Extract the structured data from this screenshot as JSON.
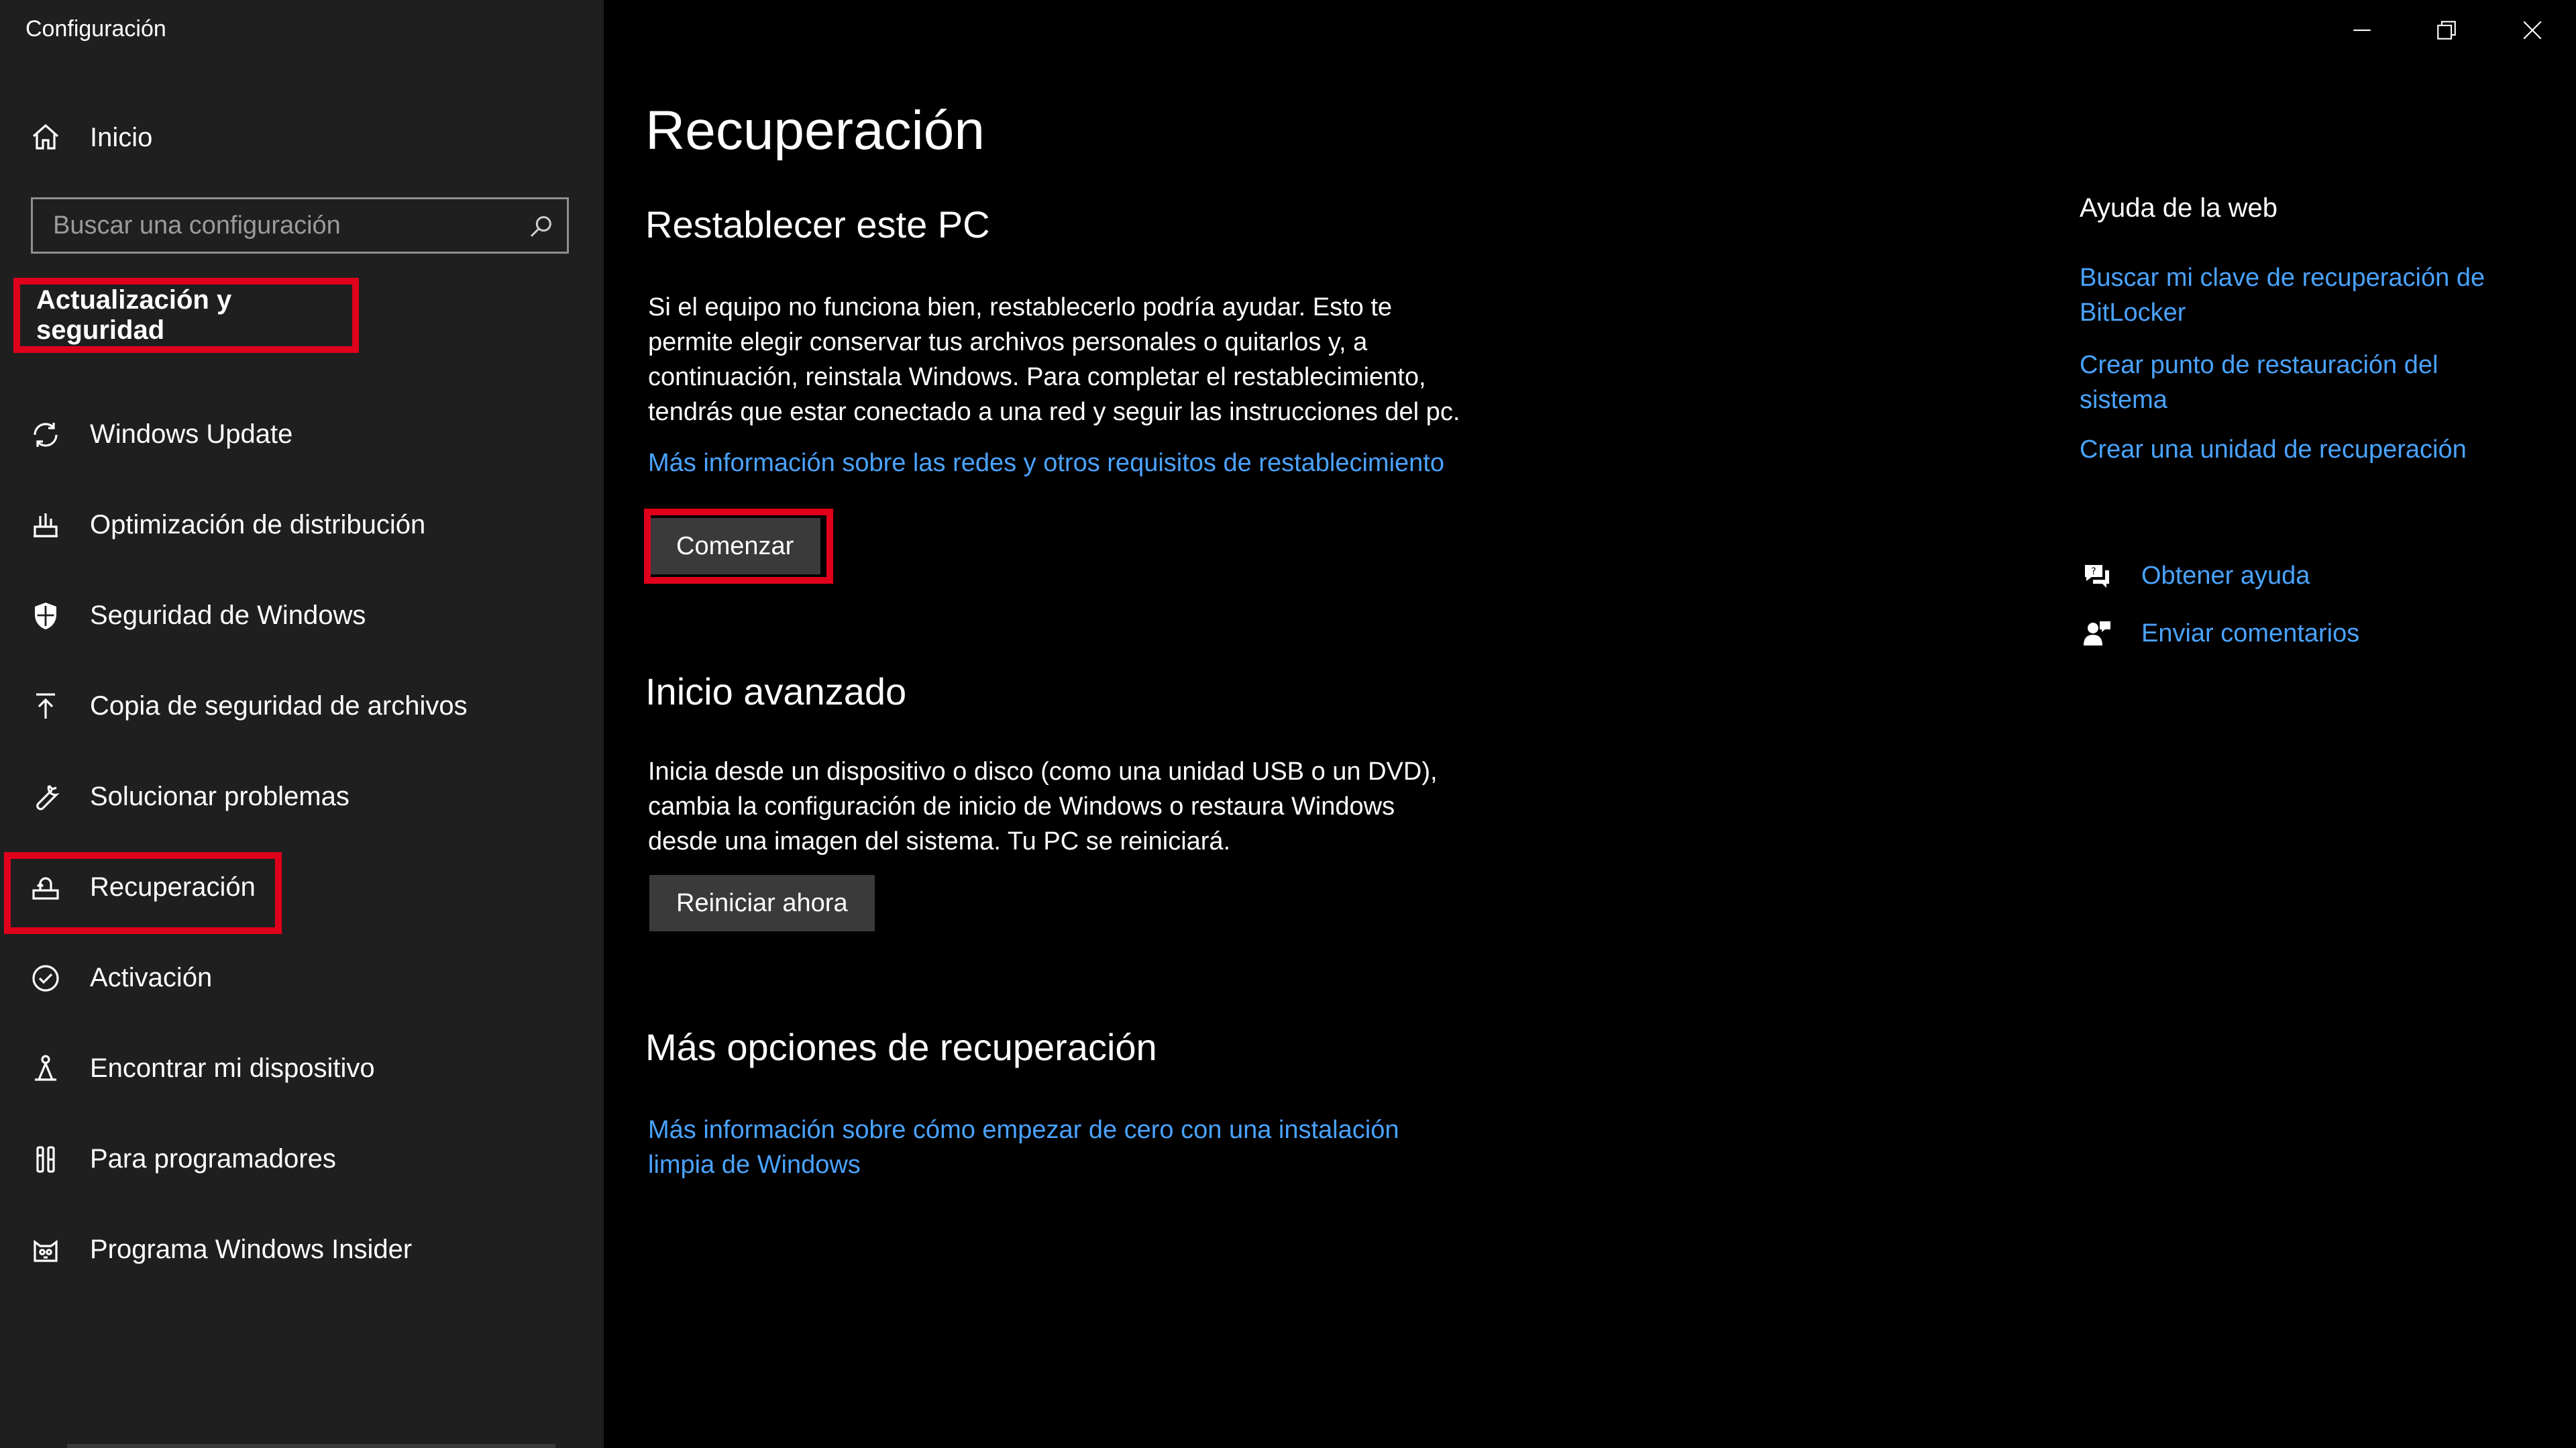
{
  "window": {
    "title": "Configuración",
    "controls": [
      "minimize-icon",
      "restore-icon",
      "close-icon"
    ]
  },
  "sidebar": {
    "home": {
      "label": "Inicio",
      "icon": "home-icon"
    },
    "search": {
      "placeholder": "Buscar una configuración",
      "value": "",
      "icon": "search-icon"
    },
    "section_label": "Actualización y seguridad",
    "items": [
      {
        "label": "Windows Update",
        "icon": "sync-icon"
      },
      {
        "label": "Optimización de distribución",
        "icon": "delivery-optimization-icon"
      },
      {
        "label": "Seguridad de Windows",
        "icon": "shield-icon"
      },
      {
        "label": "Copia de seguridad de archivos",
        "icon": "upload-arrow-icon"
      },
      {
        "label": "Solucionar problemas",
        "icon": "wrench-icon"
      },
      {
        "label": "Recuperación",
        "icon": "recovery-icon",
        "selected": true
      },
      {
        "label": "Activación",
        "icon": "check-circle-icon"
      },
      {
        "label": "Encontrar mi dispositivo",
        "icon": "person-location-icon"
      },
      {
        "label": "Para programadores",
        "icon": "developer-tools-icon"
      },
      {
        "label": "Programa Windows Insider",
        "icon": "insider-cat-icon"
      }
    ]
  },
  "main": {
    "title": "Recuperación",
    "reset": {
      "heading": "Restablecer este PC",
      "lines": [
        "Si el equipo no funciona bien, restablecerlo podría ayudar. Esto te",
        "permite elegir conservar tus archivos personales o quitarlos y, a",
        "continuación, reinstala Windows. Para completar el restablecimiento,",
        "tendrás que estar conectado a una red y seguir las instrucciones del pc."
      ],
      "link": "Más información sobre las redes y otros requisitos de restablecimiento",
      "button": "Comenzar"
    },
    "advanced": {
      "heading": "Inicio avanzado",
      "lines": [
        "Inicia desde un dispositivo o disco (como una unidad USB o un DVD),",
        "cambia la configuración de inicio de Windows o restaura Windows",
        "desde una imagen del sistema. Tu PC se reiniciará."
      ],
      "button": "Reiniciar ahora"
    },
    "more": {
      "heading": "Más opciones de recuperación",
      "link_lines": [
        "Más información sobre cómo empezar de cero con una instalación",
        "limpia de Windows"
      ]
    }
  },
  "right_panel": {
    "title": "Ayuda de la web",
    "links": [
      [
        "Buscar mi clave de recuperación de",
        "BitLocker"
      ],
      [
        "Crear punto de restauración del",
        "sistema"
      ],
      [
        "Crear una unidad de recuperación"
      ]
    ],
    "help": {
      "label": "Obtener ayuda",
      "icon": "help-chat-icon"
    },
    "feedback": {
      "label": "Enviar comentarios",
      "icon": "feedback-icon"
    }
  },
  "colors": {
    "sidebar_bg": "#1f1f1f",
    "main_bg": "#000000",
    "link": "#4aa3ff",
    "highlight": "#e0001b",
    "button_bg": "#3a3a3a"
  }
}
